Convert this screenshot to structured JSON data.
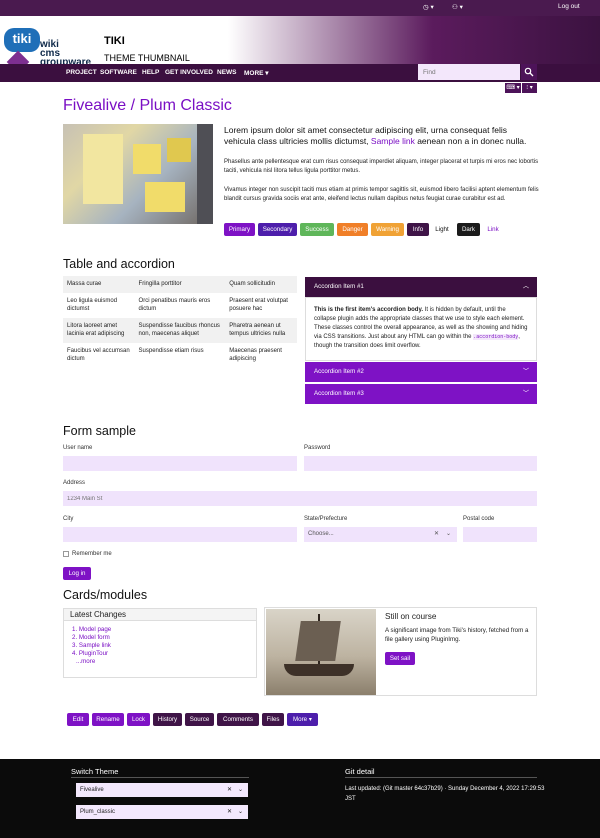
{
  "topbar": {
    "clock": "◷ ▾",
    "users": "⚇ ▾",
    "logout": "Log out"
  },
  "header": {
    "title": "TIKI",
    "subtitle": "THEME THUMBNAIL",
    "logo_text": "tiki",
    "logo_sub1": "wiki",
    "logo_sub2": "cms",
    "logo_sub3": "groupware"
  },
  "nav": {
    "items": [
      "PROJECT",
      "SOFTWARE",
      "HELP",
      "GET INVOLVED",
      "NEWS",
      "MORE ▾"
    ]
  },
  "search": {
    "placeholder": "Find"
  },
  "mini": {
    "b1": "⌨ ▾",
    "b2": "⁝ ▾"
  },
  "page": {
    "title": "Fivealive / Plum Classic",
    "lead_pre": "Lorem ipsum dolor sit amet consectetur adipiscing elit, urna consequat felis vehicula class ultricies mollis dictumst, ",
    "lead_link": "Sample link",
    "lead_post": " aenean non a in donec nulla.",
    "p1": "Phasellus ante pellentesque erat cum risus consequat imperdiet aliquam, integer placerat et turpis mi eros nec lobortis taciti, vehicula nisl litora tellus ligula porttitor metus.",
    "p2": "Vivamus integer non suscipit taciti mus etiam at primis tempor sagittis sit, euismod libero facilisi aptent elementum felis blandit cursus gravida sociis erat ante, eleifend lectus nullam dapibus netus feugiat curae curabitur est ad."
  },
  "buttons": {
    "primary": "Primary",
    "secondary": "Secondary",
    "success": "Success",
    "danger": "Danger",
    "warning": "Warning",
    "info": "Info",
    "light": "Light",
    "dark": "Dark",
    "link": "Link"
  },
  "section1": {
    "title": "Table and accordion"
  },
  "table": {
    "rows": [
      [
        "Massa curae",
        "Fringilla porttitor",
        "Quam sollicitudin"
      ],
      [
        "Leo ligula euismod dictumst",
        "Orci penatibus mauris eros dictum",
        "Praesent erat volutpat posuere hac"
      ],
      [
        "Litora laoreet amet lacinia erat adipiscing",
        "Suspendisse faucibus rhoncus non, maecenas aliquet",
        "Pharetra aenean ut tempus ultricies nulla"
      ],
      [
        "Faucibus vel accumsan dictum",
        "Suspendisse etiam risus",
        "Maecenas praesent adipiscing"
      ]
    ]
  },
  "accordion": {
    "item1": "Accordion Item #1",
    "item2": "Accordion Item #2",
    "item3": "Accordion Item #3",
    "body_bold": "This is the first item's accordion body.",
    "body_mid": " It is hidden by default, until the collapse plugin adds the appropriate classes that we use to style each element. These classes control the overall appearance, as well as the showing and hiding via CSS transitions. Just about any HTML can go within the ",
    "body_code": ".accordion-body",
    "body_post": ", though the transition does limit overflow."
  },
  "form": {
    "title": "Form sample",
    "username": "User name",
    "password": "Password",
    "address": "Address",
    "address_placeholder": "1234 Main St",
    "city": "City",
    "state": "State/Prefecture",
    "state_value": "Choose...",
    "postal": "Postal code",
    "remember": "Remember me",
    "login": "Log in"
  },
  "cards": {
    "title": "Cards/modules",
    "latest_title": "Latest Changes",
    "latest": [
      "1. Model page",
      "2. Model form",
      "3. Sample link",
      "4. PluginTour"
    ],
    "more": "...more",
    "card2_title": "Still on course",
    "card2_text": "A significant image from Tiki's history, fetched from a file gallery using PluginImg.",
    "card2_btn": "Set sail"
  },
  "actions": [
    "Edit",
    "Rename",
    "Lock",
    "History",
    "Source",
    "Comments",
    "Files",
    "More ▾"
  ],
  "footer": {
    "switch_title": "Switch Theme",
    "theme1": "Fivealive",
    "theme2": "Plum_classic",
    "git_title": "Git detail",
    "git_text": "Last updated: (Git master 64c37b29) · Sunday December 4, 2022 17:29:53 JST"
  },
  "colors": {
    "primary": "#7e12c5",
    "secondary": "#4d1eab",
    "success": "#5fb65a",
    "danger": "#f07f28",
    "warning": "#f0a235",
    "info": "#3f1447",
    "dark": "#1b1b1b"
  }
}
